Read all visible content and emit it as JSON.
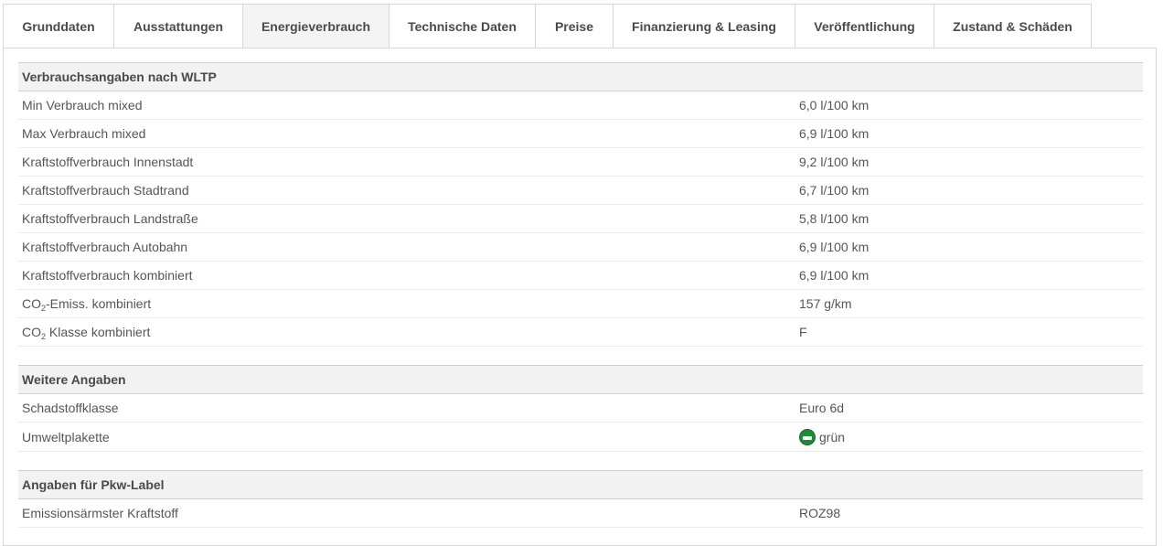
{
  "tabs": [
    {
      "label": "Grunddaten",
      "active": false
    },
    {
      "label": "Ausstattungen",
      "active": false
    },
    {
      "label": "Energieverbrauch",
      "active": true
    },
    {
      "label": "Technische Daten",
      "active": false
    },
    {
      "label": "Preise",
      "active": false
    },
    {
      "label": "Finanzierung & Leasing",
      "active": false
    },
    {
      "label": "Veröffentlichung",
      "active": false
    },
    {
      "label": "Zustand & Schäden",
      "active": false
    }
  ],
  "wltp": {
    "title": "Verbrauchsangaben nach WLTP",
    "rows": [
      {
        "label": "Min Verbrauch mixed",
        "value": "6,0 l/100 km"
      },
      {
        "label": "Max Verbrauch mixed",
        "value": "6,9 l/100 km"
      },
      {
        "label": "Kraftstoffverbrauch Innenstadt",
        "value": "9,2 l/100 km"
      },
      {
        "label": "Kraftstoffverbrauch Stadtrand",
        "value": "6,7 l/100 km"
      },
      {
        "label": "Kraftstoffverbrauch Landstraße",
        "value": "5,8 l/100 km"
      },
      {
        "label": "Kraftstoffverbrauch Autobahn",
        "value": "6,9 l/100 km"
      },
      {
        "label": "Kraftstoffverbrauch kombiniert",
        "value": "6,9 l/100 km"
      }
    ],
    "co2_emiss": {
      "prefix": "CO",
      "sub": "2",
      "suffix": "-Emiss. kombiniert",
      "value": "157 g/km"
    },
    "co2_klasse": {
      "prefix": "CO",
      "sub": "2",
      "suffix": " Klasse kombiniert",
      "value": "F"
    }
  },
  "weitere": {
    "title": "Weitere Angaben",
    "schadstoff": {
      "label": "Schadstoffklasse",
      "value": "Euro 6d"
    },
    "umwelt": {
      "label": "Umweltplakette",
      "value": "grün",
      "icon": "green-badge-icon",
      "icon_color": "#1f8a3c"
    }
  },
  "pkw": {
    "title": "Angaben für Pkw-Label",
    "rows": [
      {
        "label": "Emissionsärmster Kraftstoff",
        "value": "ROZ98"
      }
    ]
  }
}
